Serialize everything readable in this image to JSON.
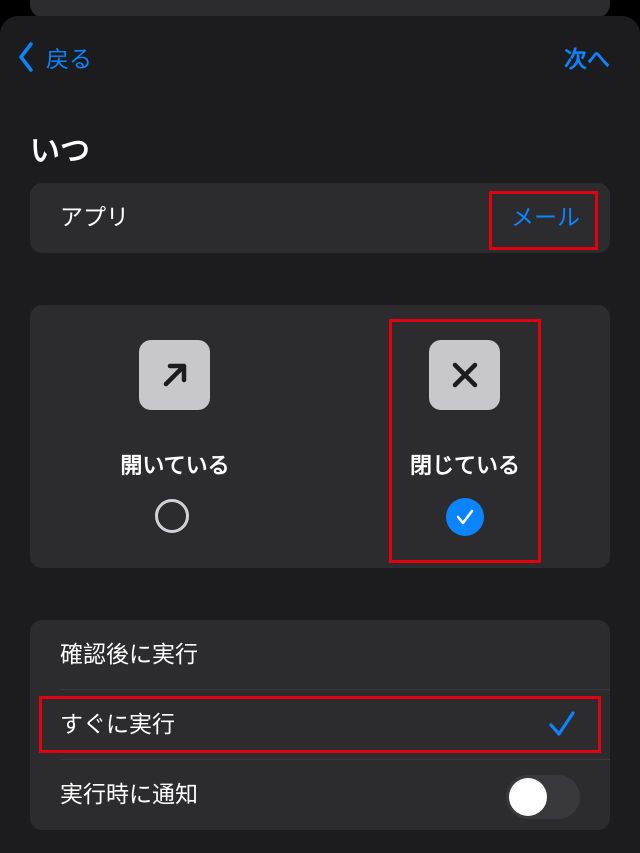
{
  "nav": {
    "back_label": "戻る",
    "next_label": "次へ"
  },
  "section": {
    "title": "いつ"
  },
  "app_row": {
    "label": "アプリ",
    "value": "メール"
  },
  "state": {
    "options": [
      {
        "label": "開いている",
        "icon": "arrow-up-right-icon",
        "selected": false
      },
      {
        "label": "閉じている",
        "icon": "x-mark-icon",
        "selected": true
      }
    ]
  },
  "run": {
    "options": [
      {
        "label": "確認後に実行",
        "selected": false
      },
      {
        "label": "すぐに実行",
        "selected": true
      }
    ],
    "notify": {
      "label": "実行時に通知",
      "enabled": false
    }
  },
  "colors": {
    "accent": "#0a84ff",
    "highlight": "#e3000f",
    "background": "#1c1c1e",
    "card": "#2c2c2e"
  }
}
